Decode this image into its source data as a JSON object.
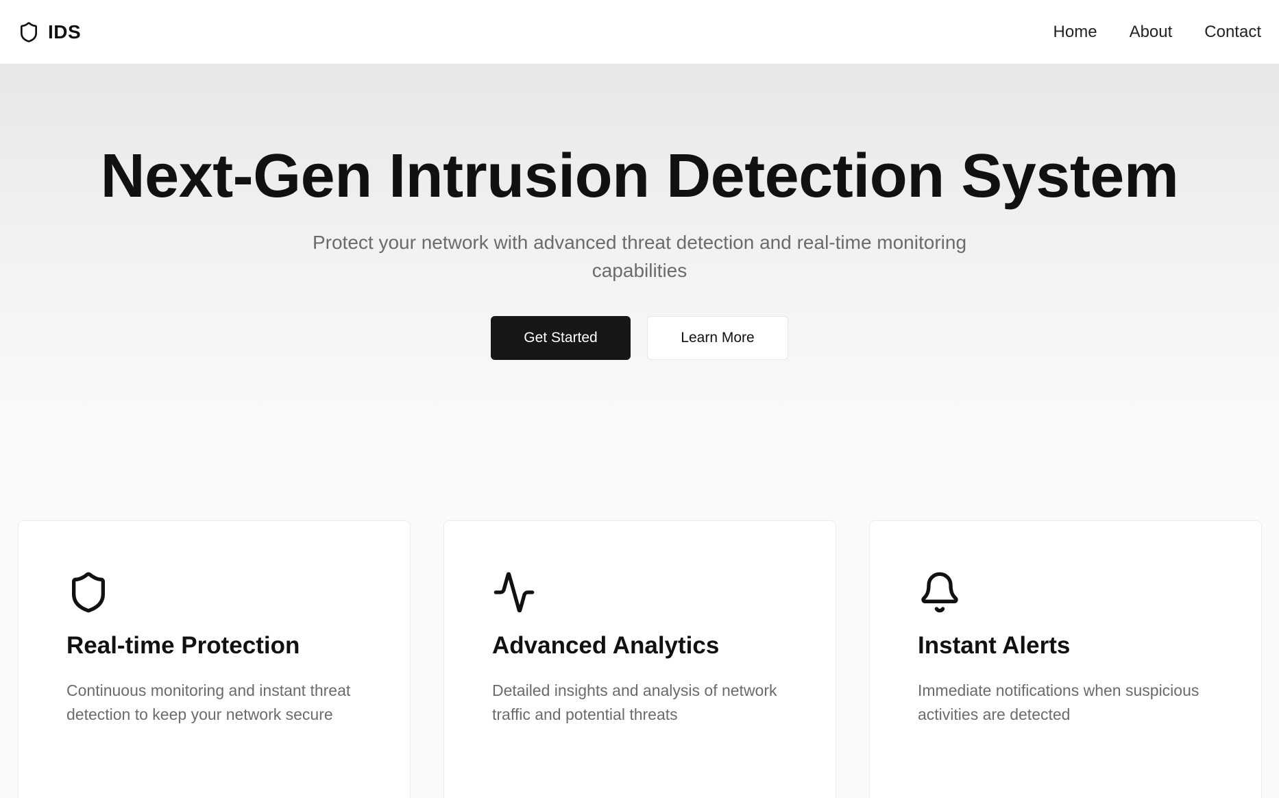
{
  "navbar": {
    "brand": "IDS",
    "brand_icon": "shield-icon",
    "links": [
      "Home",
      "About",
      "Contact"
    ]
  },
  "hero": {
    "title": "Next-Gen Intrusion Detection System",
    "subtitle": "Protect your network with advanced threat detection and real-time monitoring capabilities",
    "primary_button": "Get Started",
    "secondary_button": "Learn More"
  },
  "features": [
    {
      "icon": "shield-icon",
      "title": "Real-time Protection",
      "description": "Continuous monitoring and instant threat detection to keep your network secure"
    },
    {
      "icon": "activity-icon",
      "title": "Advanced Analytics",
      "description": "Detailed insights and analysis of network traffic and potential threats"
    },
    {
      "icon": "bell-icon",
      "title": "Instant Alerts",
      "description": "Immediate notifications when suspicious activities are detected"
    }
  ],
  "colors": {
    "primary": "#171717",
    "muted_text": "#6b6b6b",
    "hero_gradient_top": "#e7e7e7"
  }
}
